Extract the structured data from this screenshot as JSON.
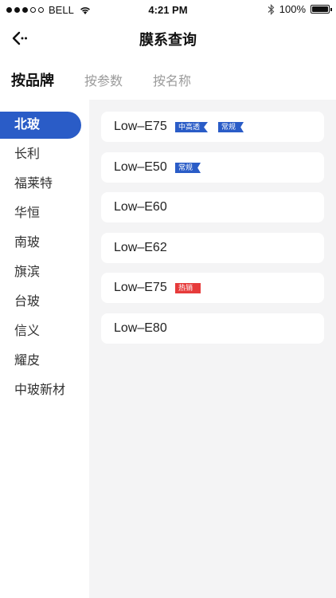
{
  "status": {
    "carrier": "BELL",
    "time": "4:21 PM",
    "battery": "100%"
  },
  "nav": {
    "title": "膜系查询"
  },
  "tabs": [
    {
      "label": "按品牌"
    },
    {
      "label": "按参数"
    },
    {
      "label": "按名称"
    }
  ],
  "brands": [
    "北玻",
    "长利",
    "福莱特",
    "华恒",
    "南玻",
    "旗滨",
    "台玻",
    "信义",
    "耀皮",
    "中玻新材"
  ],
  "products": [
    {
      "name": "Low–E75",
      "tag1": "中高透",
      "tag2": "常规"
    },
    {
      "name": "Low–E50",
      "tag1": "常规"
    },
    {
      "name": "Low–E60"
    },
    {
      "name": "Low–E62"
    },
    {
      "name": "Low–E75",
      "tag1": "热销"
    },
    {
      "name": "Low–E80"
    }
  ],
  "colors": {
    "accent": "#2a5cc7",
    "hot": "#e63b3b"
  }
}
